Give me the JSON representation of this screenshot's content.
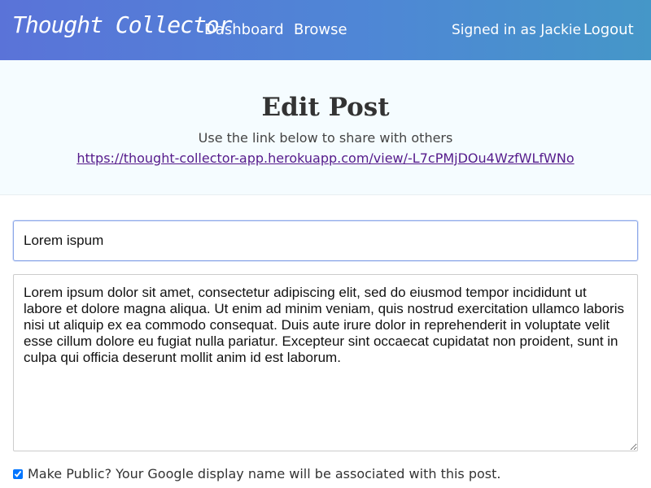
{
  "navbar": {
    "brand": "Thought Collector",
    "links": [
      "Dashboard",
      "Browse"
    ],
    "user_text": "Signed in as Jackie",
    "logout_label": "Logout"
  },
  "hero": {
    "title": "Edit Post",
    "subtitle": "Use the link below to share with others",
    "share_link": "https://thought-collector-app.herokuapp.com/view/-L7cPMjDOu4WzfWLfWNo"
  },
  "form": {
    "title_value": "Lorem ispum",
    "body_value": "Lorem ipsum dolor sit amet, consectetur adipiscing elit, sed do eiusmod tempor incididunt ut labore et dolore magna aliqua. Ut enim ad minim veniam, quis nostrud exercitation ullamco laboris nisi ut aliquip ex ea commodo consequat. Duis aute irure dolor in reprehenderit in voluptate velit esse cillum dolore eu fugiat nulla pariatur. Excepteur sint occaecat cupidatat non proident, sunt in culpa qui officia deserunt mollit anim id est laborum.",
    "public_checked": true,
    "public_label": "Make Public? Your Google display name will be associated with this post."
  },
  "colors": {
    "navbar_gradient_start": "#5a73d8",
    "navbar_gradient_end": "#4597c8",
    "hero_background": "#f5fcff",
    "link_color": "#551a8b"
  }
}
